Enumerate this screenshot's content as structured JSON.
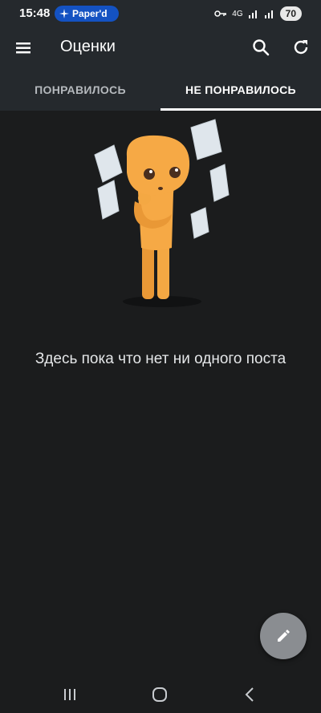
{
  "status_bar": {
    "time": "15:48",
    "pill_text": "Paper'd",
    "network": "4G",
    "battery": "70"
  },
  "app_bar": {
    "title": "Оценки",
    "icons": [
      "menu-icon",
      "search-icon",
      "refresh-icon"
    ]
  },
  "tabs": [
    {
      "label": "ПОНРАВИЛОСЬ",
      "active": false
    },
    {
      "label": "НЕ ПОНРАВИЛОСЬ",
      "active": true
    }
  ],
  "empty_state": {
    "message": "Здесь пока что нет ни одного поста"
  },
  "fab": {
    "icon": "pencil-icon"
  },
  "colors": {
    "background": "#1b1c1d",
    "toolbar": "#25292d",
    "character": "#f6a945",
    "fab": "#8a8d91",
    "pill": "#1452c2"
  }
}
